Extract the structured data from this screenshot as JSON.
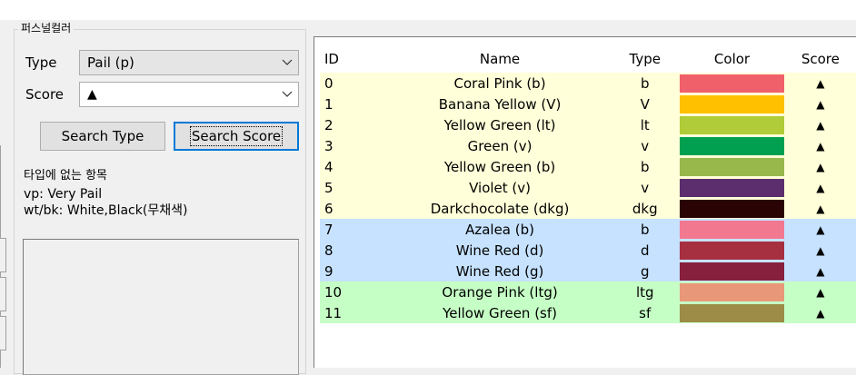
{
  "group_title": "퍼스널컬러",
  "type_label": "Type",
  "type_value": "Pail (p)",
  "score_label": "Score",
  "score_value": "▲",
  "search_type_label": "Search Type",
  "search_score_label": "Search Score",
  "info_heading": "타입에 없는 항목",
  "info_line1": "vp: Very Pail",
  "info_line2": "wt/bk: White,Black(무채색)",
  "columns": {
    "id": "ID",
    "name": "Name",
    "type": "Type",
    "color": "Color",
    "score": "Score"
  },
  "row_colors": {
    "yellow": "#ffffd9",
    "blue": "#c6e2ff",
    "green": "#c6ffc6"
  },
  "rows": [
    {
      "id": "0",
      "name": "Coral Pink (b)",
      "type": "b",
      "color": "#f0606a",
      "score": "▲",
      "group": "yellow"
    },
    {
      "id": "1",
      "name": "Banana Yellow (V)",
      "type": "V",
      "color": "#ffc000",
      "score": "▲",
      "group": "yellow"
    },
    {
      "id": "2",
      "name": "Yellow Green (lt)",
      "type": "lt",
      "color": "#b0cc38",
      "score": "▲",
      "group": "yellow"
    },
    {
      "id": "3",
      "name": "Green (v)",
      "type": "v",
      "color": "#00a050",
      "score": "▲",
      "group": "yellow"
    },
    {
      "id": "4",
      "name": "Yellow Green (b)",
      "type": "b",
      "color": "#98b84c",
      "score": "▲",
      "group": "yellow"
    },
    {
      "id": "5",
      "name": "Violet (v)",
      "type": "v",
      "color": "#5c2e6e",
      "score": "▲",
      "group": "yellow"
    },
    {
      "id": "6",
      "name": "Darkchocolate (dkg)",
      "type": "dkg",
      "color": "#2a0404",
      "score": "▲",
      "group": "yellow"
    },
    {
      "id": "7",
      "name": "Azalea (b)",
      "type": "b",
      "color": "#f27890",
      "score": "▲",
      "group": "blue"
    },
    {
      "id": "8",
      "name": "Wine Red (d)",
      "type": "d",
      "color": "#a63040",
      "score": "▲",
      "group": "blue"
    },
    {
      "id": "9",
      "name": "Wine Red (g)",
      "type": "g",
      "color": "#86203c",
      "score": "▲",
      "group": "blue"
    },
    {
      "id": "10",
      "name": "Orange Pink (ltg)",
      "type": "ltg",
      "color": "#e89878",
      "score": "▲",
      "group": "green"
    },
    {
      "id": "11",
      "name": "Yellow Green (sf)",
      "type": "sf",
      "color": "#9c8c48",
      "score": "▲",
      "group": "green"
    }
  ]
}
